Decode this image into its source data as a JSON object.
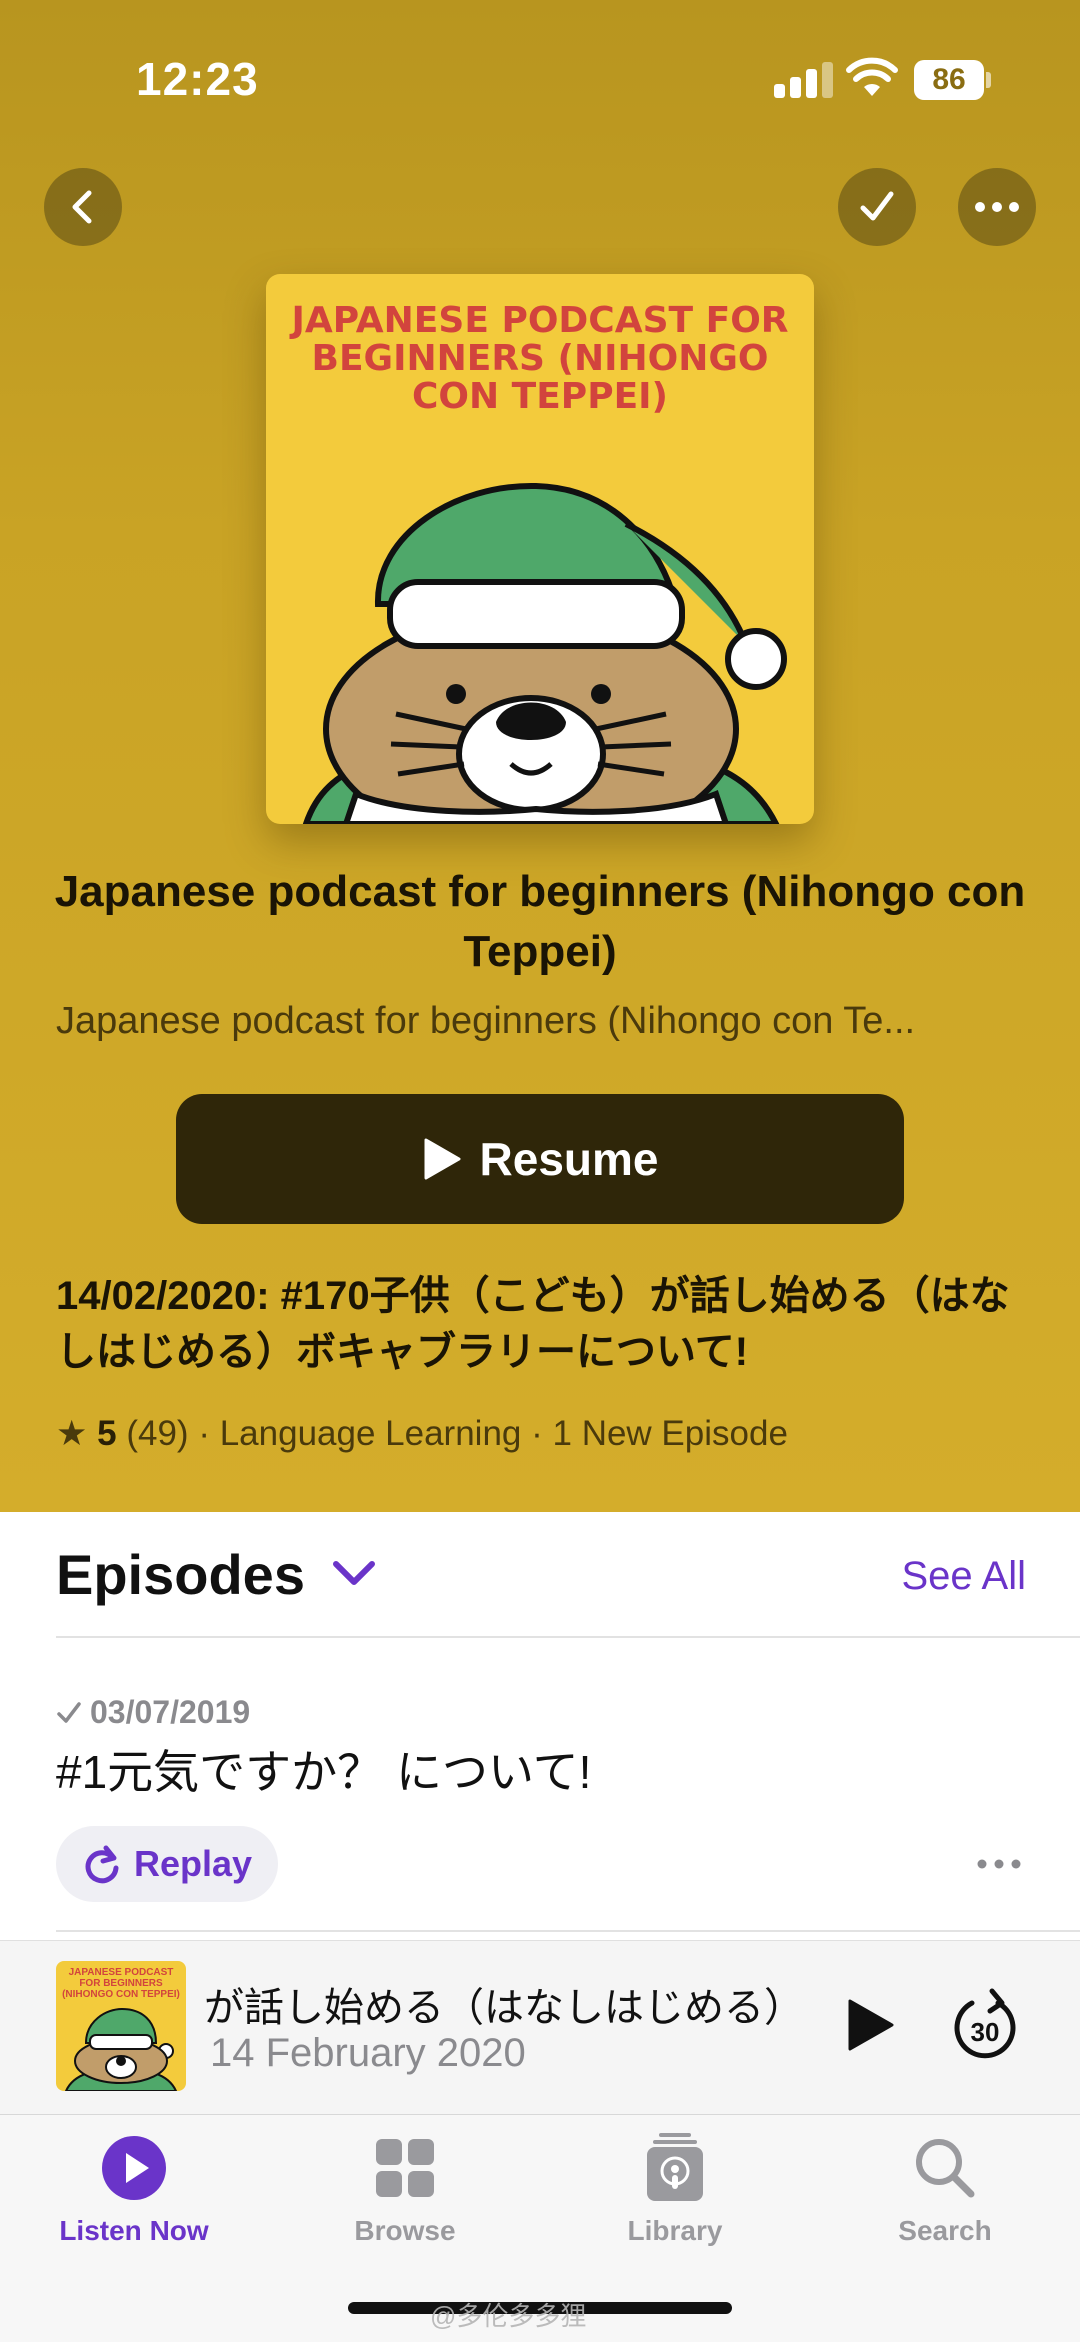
{
  "status_bar": {
    "time": "12:23",
    "battery": "86"
  },
  "podcast": {
    "artwork_text": "JAPANESE PODCAST FOR BEGINNERS (NIHONGO CON TEPPEI)",
    "title": "Japanese podcast for beginners (Nihongo con Teppei)",
    "author": "Japanese podcast for beginners (Nihongo con Te...",
    "resume_label": "Resume",
    "latest_episode": "14/02/2020: #170子供（こども）が話し始める（はなしはじめる）ボキャブラリーについて!",
    "rating": "5",
    "rating_count": "(49)",
    "category": "Language Learning",
    "new_episodes": "1 New Episode"
  },
  "episodes": {
    "heading": "Episodes",
    "see_all": "See All",
    "items": [
      {
        "date": "03/07/2019",
        "title": "#1元気ですか？ について!",
        "action": "Replay"
      }
    ]
  },
  "mini_player": {
    "artwork_text": "JAPANESE PODCAST FOR BEGINNERS (NIHONGO CON TEPPEI)",
    "title": "が話し始める（はなしはじめる）",
    "date": "14 February 2020",
    "skip_seconds": "30"
  },
  "tab_bar": {
    "tabs": [
      {
        "label": "Listen Now",
        "icon": "play-circle-icon",
        "active": true
      },
      {
        "label": "Browse",
        "icon": "grid-icon",
        "active": false
      },
      {
        "label": "Library",
        "icon": "library-icon",
        "active": false
      },
      {
        "label": "Search",
        "icon": "search-icon",
        "active": false
      }
    ]
  },
  "watermark": "@多伦多多狸",
  "colors": {
    "accent": "#6a34c9",
    "hero_background": "#c9a325",
    "resume_button": "#2f2609",
    "artwork_background": "#f3cb3c",
    "artwork_text": "#d2443d"
  }
}
